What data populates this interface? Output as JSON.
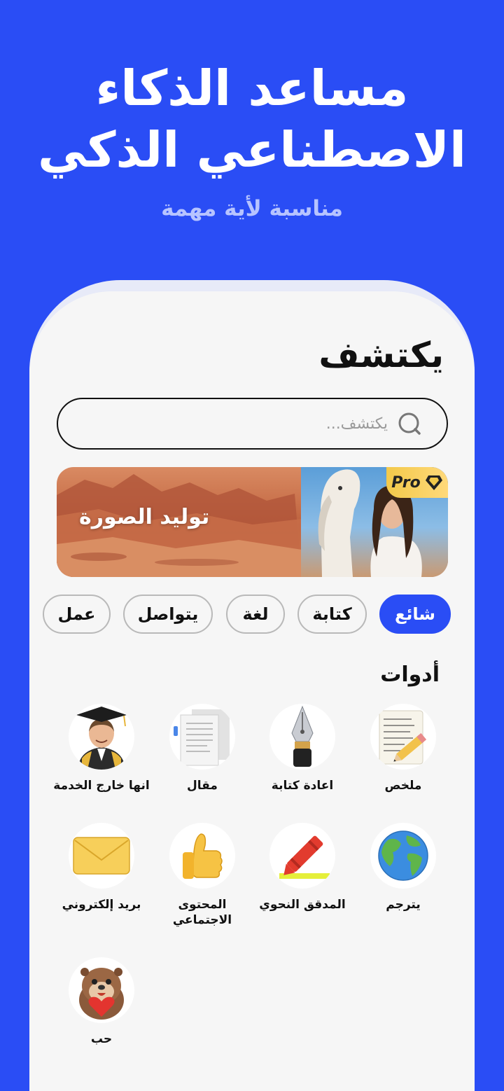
{
  "hero": {
    "title_line1": "مساعد الذكاء",
    "title_line2": "الاصطناعي الذكي",
    "subtitle": "مناسبة لأية مهمة"
  },
  "page": {
    "title": "يكتشف"
  },
  "search": {
    "placeholder": "يكتشف..."
  },
  "banner": {
    "label": "توليد الصورة",
    "badge": "Pro"
  },
  "categories": [
    "شائع",
    "كتابة",
    "لغة",
    "يتواصل",
    "عمل"
  ],
  "tools_section": {
    "title": "أدوات"
  },
  "tools": [
    {
      "label": "ملخص",
      "icon": "notepad-pencil-icon"
    },
    {
      "label": "اعادة كتابة",
      "icon": "fountain-pen-icon"
    },
    {
      "label": "مقال",
      "icon": "document-icon"
    },
    {
      "label": "انها خارج الخدمة",
      "icon": "graduate-avatar-icon"
    },
    {
      "label": "يترجم",
      "icon": "globe-icon"
    },
    {
      "label": "المدقق النحوي",
      "icon": "crayon-icon"
    },
    {
      "label_line1": "المحتوى",
      "label_line2": "الاجتماعي",
      "icon": "thumbs-up-icon"
    },
    {
      "label": "بريد إلكتروني",
      "icon": "envelope-icon"
    },
    {
      "label": "حب",
      "icon": "otter-heart-icon"
    }
  ],
  "colors": {
    "brand": "#2a4df5",
    "active_chip": "#2a4df5",
    "pro_badge": "#f3c94a"
  }
}
